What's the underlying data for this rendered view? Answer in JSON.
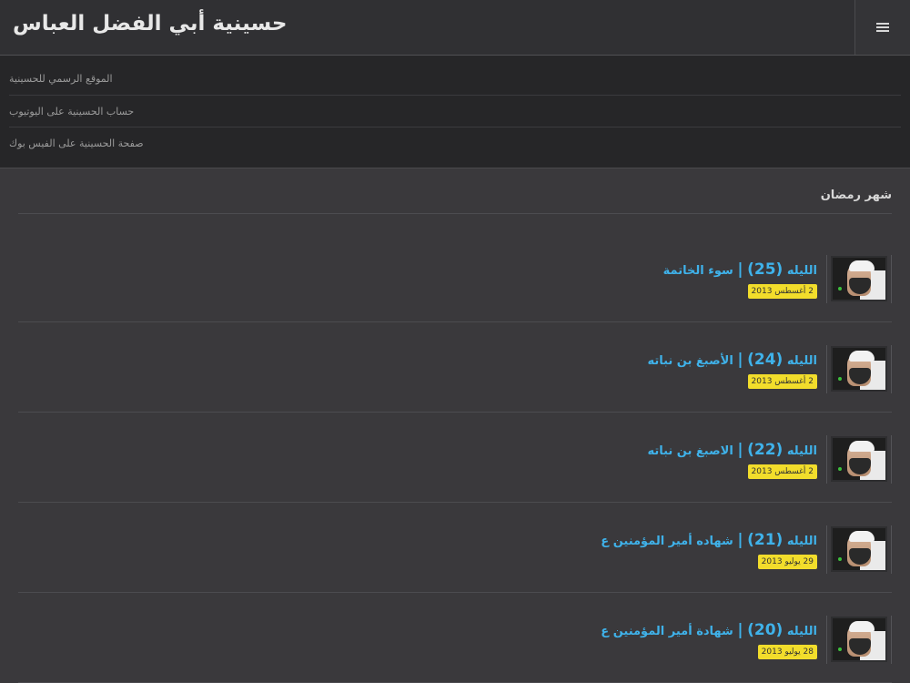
{
  "header": {
    "site_title": "حسينية أبي الفضل العباس",
    "menu_icon": "hamburger-icon"
  },
  "nav": {
    "items": [
      {
        "label": "الموقع الرسمي للحسينية"
      },
      {
        "label": "حساب الحسينية على اليوتيوب"
      },
      {
        "label": "صفحة الحسينية على الفيس بوك"
      }
    ]
  },
  "section": {
    "title": "شهر رمضان"
  },
  "items": [
    {
      "night": "الليله",
      "number": "(25)",
      "sep": "|",
      "subject": "سوء الخاتمة",
      "date": "2 أغسطس 2013"
    },
    {
      "night": "الليله",
      "number": "(24)",
      "sep": "|",
      "subject": "الأصبغ بن نباته",
      "date": "2 أغسطس 2013"
    },
    {
      "night": "الليله",
      "number": "(22)",
      "sep": "|",
      "subject": "الاصبغ بن نباته",
      "date": "2 أغسطس 2013"
    },
    {
      "night": "الليله",
      "number": "(21)",
      "sep": "|",
      "subject": "شهاده أمير المؤمنين ع",
      "date": "29 يوليو 2013"
    },
    {
      "night": "الليله",
      "number": "(20)",
      "sep": "|",
      "subject": "شهادة أمير المؤمنين ع",
      "date": "28 يوليو 2013"
    }
  ],
  "colors": {
    "link": "#3fb2ea",
    "badge": "#f2dd2b",
    "background": "#3a393c"
  }
}
